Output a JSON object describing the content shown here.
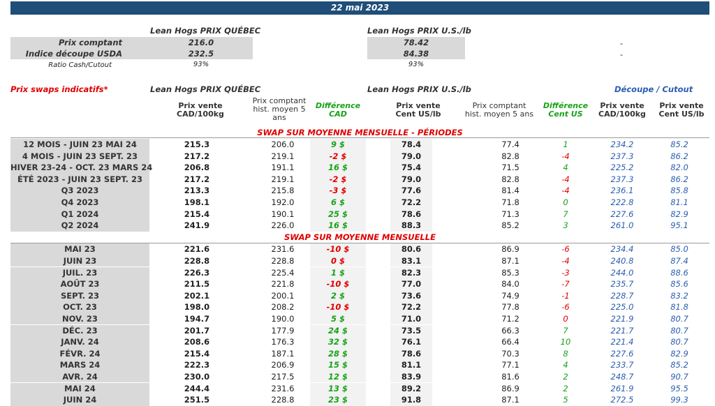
{
  "header": {
    "date": "22 mai 2023"
  },
  "summary": {
    "quebec_title": "Lean Hogs PRIX QUÉBEC",
    "us_title": "Lean Hogs PRIX U.S./lb",
    "rows": [
      {
        "label": "Prix comptant",
        "quebec": "216.0",
        "us": "78.42",
        "extra": "-"
      },
      {
        "label": "Indice découpe USDA",
        "quebec": "232.5",
        "us": "84.38",
        "extra": "-"
      },
      {
        "label": "Ratio Cash/Cutout",
        "quebec": "93%",
        "us": "93%",
        "extra": ""
      }
    ]
  },
  "swaps": {
    "title": "Prix swaps indicatifs*",
    "quebec_title": "Lean Hogs PRIX QUÉBEC",
    "us_title": "Lean Hogs PRIX U.S./lb",
    "cutout_title": "Découpe / Cutout",
    "columns": {
      "pv_cad": "Prix vente\nCAD/100kg",
      "pc_hist": "Prix comptant\nhist. moyen 5\nans",
      "diff_cad": "Différence\nCAD",
      "pv_us": "Prix vente\nCent US/lb",
      "pc_hist_us": "Prix comptant\nhist. moyen 5 ans",
      "diff_us": "Différence\nCent US",
      "cut_cad": "Prix vente\nCAD/100kg",
      "cut_us": "Prix vente\nCent US/lb"
    },
    "section1": "SWAP SUR MOYENNE MENSUELLE - PÉRIODES",
    "section2": "SWAP SUR MOYENNE MENSUELLE",
    "periods": [
      {
        "label": "12 MOIS - JUIN 23 MAI 24",
        "pv": "215.3",
        "pc": "206.0",
        "diff": "9 $",
        "diff_color": "green",
        "pvu": "78.4",
        "pcu": "77.4",
        "dus": "1",
        "dus_color": "green",
        "ccad": "234.2",
        "cus": "85.2"
      },
      {
        "label": "4 MOIS - JUIN 23 SEPT. 23",
        "pv": "217.2",
        "pc": "219.1",
        "diff": "-2 $",
        "diff_color": "red",
        "pvu": "79.0",
        "pcu": "82.8",
        "dus": "-4",
        "dus_color": "red",
        "ccad": "237.3",
        "cus": "86.2"
      },
      {
        "label": "HIVER 23-24 - OCT. 23 MARS 24",
        "pv": "206.8",
        "pc": "191.1",
        "diff": "16 $",
        "diff_color": "green",
        "pvu": "75.4",
        "pcu": "71.5",
        "dus": "4",
        "dus_color": "green",
        "ccad": "225.2",
        "cus": "82.0"
      },
      {
        "label": "ÉTÉ 2023 - JUIN 23 SEPT. 23",
        "pv": "217.2",
        "pc": "219.1",
        "diff": "-2 $",
        "diff_color": "red",
        "pvu": "79.0",
        "pcu": "82.8",
        "dus": "-4",
        "dus_color": "red",
        "ccad": "237.3",
        "cus": "86.2"
      },
      {
        "label": "Q3 2023",
        "pv": "213.3",
        "pc": "215.8",
        "diff": "-3 $",
        "diff_color": "red",
        "pvu": "77.6",
        "pcu": "81.4",
        "dus": "-4",
        "dus_color": "red",
        "ccad": "236.1",
        "cus": "85.8"
      },
      {
        "label": "Q4 2023",
        "pv": "198.1",
        "pc": "192.0",
        "diff": "6 $",
        "diff_color": "green",
        "pvu": "72.2",
        "pcu": "71.8",
        "dus": "0",
        "dus_color": "green",
        "ccad": "222.8",
        "cus": "81.1"
      },
      {
        "label": "Q1 2024",
        "pv": "215.4",
        "pc": "190.1",
        "diff": "25 $",
        "diff_color": "green",
        "pvu": "78.6",
        "pcu": "71.3",
        "dus": "7",
        "dus_color": "green",
        "ccad": "227.6",
        "cus": "82.9"
      },
      {
        "label": "Q2 2024",
        "pv": "241.9",
        "pc": "226.0",
        "diff": "16 $",
        "diff_color": "green",
        "pvu": "88.3",
        "pcu": "85.2",
        "dus": "3",
        "dus_color": "green",
        "ccad": "261.0",
        "cus": "95.1"
      }
    ],
    "months": [
      {
        "label": "MAI 23",
        "pv": "221.6",
        "pc": "231.6",
        "diff": "-10 $",
        "diff_color": "red",
        "pvu": "80.6",
        "pcu": "86.9",
        "dus": "-6",
        "dus_color": "red",
        "ccad": "234.4",
        "cus": "85.0"
      },
      {
        "label": "JUIN 23",
        "pv": "228.8",
        "pc": "228.8",
        "diff": "0 $",
        "diff_color": "red",
        "pvu": "83.1",
        "pcu": "87.1",
        "dus": "-4",
        "dus_color": "red",
        "ccad": "240.8",
        "cus": "87.4"
      },
      {
        "label": "JUIL. 23",
        "pv": "226.3",
        "pc": "225.4",
        "diff": "1 $",
        "diff_color": "green",
        "pvu": "82.3",
        "pcu": "85.3",
        "dus": "-3",
        "dus_color": "red",
        "ccad": "244.0",
        "cus": "88.6"
      },
      {
        "label": "AOÛT 23",
        "pv": "211.5",
        "pc": "221.8",
        "diff": "-10 $",
        "diff_color": "red",
        "pvu": "77.0",
        "pcu": "84.0",
        "dus": "-7",
        "dus_color": "red",
        "ccad": "235.7",
        "cus": "85.6"
      },
      {
        "label": "SEPT. 23",
        "pv": "202.1",
        "pc": "200.1",
        "diff": "2 $",
        "diff_color": "green",
        "pvu": "73.6",
        "pcu": "74.9",
        "dus": "-1",
        "dus_color": "red",
        "ccad": "228.7",
        "cus": "83.2"
      },
      {
        "label": "OCT. 23",
        "pv": "198.0",
        "pc": "208.2",
        "diff": "-10 $",
        "diff_color": "red",
        "pvu": "72.2",
        "pcu": "77.8",
        "dus": "-6",
        "dus_color": "red",
        "ccad": "225.0",
        "cus": "81.8"
      },
      {
        "label": "NOV. 23",
        "pv": "194.7",
        "pc": "190.0",
        "diff": "5 $",
        "diff_color": "green",
        "pvu": "71.0",
        "pcu": "71.2",
        "dus": "0",
        "dus_color": "red",
        "ccad": "221.9",
        "cus": "80.7"
      },
      {
        "label": "DÉC. 23",
        "pv": "201.7",
        "pc": "177.9",
        "diff": "24 $",
        "diff_color": "green",
        "pvu": "73.5",
        "pcu": "66.3",
        "dus": "7",
        "dus_color": "green",
        "ccad": "221.7",
        "cus": "80.7"
      },
      {
        "label": "JANV. 24",
        "pv": "208.6",
        "pc": "176.3",
        "diff": "32 $",
        "diff_color": "green",
        "pvu": "76.1",
        "pcu": "66.4",
        "dus": "10",
        "dus_color": "green",
        "ccad": "221.4",
        "cus": "80.7"
      },
      {
        "label": "FÉVR. 24",
        "pv": "215.4",
        "pc": "187.1",
        "diff": "28 $",
        "diff_color": "green",
        "pvu": "78.6",
        "pcu": "70.3",
        "dus": "8",
        "dus_color": "green",
        "ccad": "227.6",
        "cus": "82.9"
      },
      {
        "label": "MARS 24",
        "pv": "222.3",
        "pc": "206.9",
        "diff": "15 $",
        "diff_color": "green",
        "pvu": "81.1",
        "pcu": "77.1",
        "dus": "4",
        "dus_color": "green",
        "ccad": "233.7",
        "cus": "85.2"
      },
      {
        "label": "AVR. 24",
        "pv": "230.0",
        "pc": "217.5",
        "diff": "12 $",
        "diff_color": "green",
        "pvu": "83.9",
        "pcu": "81.6",
        "dus": "2",
        "dus_color": "green",
        "ccad": "248.7",
        "cus": "90.7"
      },
      {
        "label": "MAI 24",
        "pv": "244.4",
        "pc": "231.6",
        "diff": "13 $",
        "diff_color": "green",
        "pvu": "89.2",
        "pcu": "86.9",
        "dus": "2",
        "dus_color": "green",
        "ccad": "261.9",
        "cus": "95.5"
      },
      {
        "label": "JUIN 24",
        "pv": "251.5",
        "pc": "228.8",
        "diff": "23 $",
        "diff_color": "green",
        "pvu": "91.8",
        "pcu": "87.1",
        "dus": "5",
        "dus_color": "green",
        "ccad": "272.5",
        "cus": "99.3"
      }
    ]
  }
}
